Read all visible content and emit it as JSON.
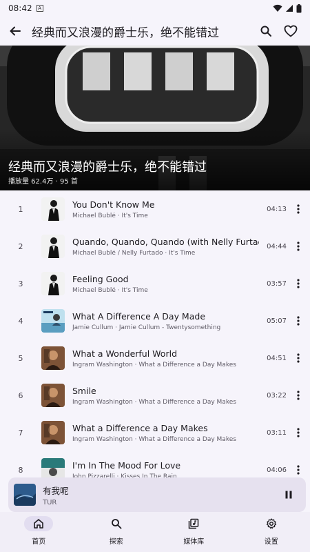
{
  "status": {
    "time": "08:42",
    "badge": "A"
  },
  "app_bar": {
    "title": "经典而又浪漫的爵士乐，绝不能错过",
    "icons": [
      "back-arrow-icon",
      "search-icon",
      "heart-icon"
    ]
  },
  "hero": {
    "title": "经典而又浪漫的爵士乐，绝不能错过",
    "meta": "播放量 62.4万 · 95 首"
  },
  "songs": [
    {
      "index": "1",
      "title": "You Don't Know Me",
      "subtitle": "Michael Bublé · It's Time",
      "duration": "04:13",
      "cover": "bw"
    },
    {
      "index": "2",
      "title": "Quando, Quando, Quando (with Nelly Furtado)",
      "subtitle": "Michael Bublé / Nelly Furtado · It's Time",
      "duration": "04:44",
      "cover": "bw"
    },
    {
      "index": "3",
      "title": "Feeling Good",
      "subtitle": "Michael Bublé · It's Time",
      "duration": "03:57",
      "cover": "bw"
    },
    {
      "index": "4",
      "title": "What A Difference A Day Made",
      "subtitle": "Jamie Cullum · Jamie Cullum - Twentysomething",
      "duration": "05:07",
      "cover": "blue"
    },
    {
      "index": "5",
      "title": "What a Wonderful World",
      "subtitle": "Ingram Washington · What a Difference a Day Makes",
      "duration": "04:51",
      "cover": "warm"
    },
    {
      "index": "6",
      "title": "Smile",
      "subtitle": "Ingram Washington · What a Difference a Day Makes",
      "duration": "03:22",
      "cover": "warm"
    },
    {
      "index": "7",
      "title": "What a Difference a Day Makes",
      "subtitle": "Ingram Washington · What a Difference a Day Makes",
      "duration": "03:11",
      "cover": "warm"
    },
    {
      "index": "8",
      "title": "I'm In The Mood For Love",
      "subtitle": "John Pizzarelli · Kisses In The Rain",
      "duration": "04:06",
      "cover": "teal"
    }
  ],
  "mini_player": {
    "title": "有我呢",
    "artist": "TUR"
  },
  "nav": [
    {
      "label": "首页",
      "icon": "home-icon",
      "active": true
    },
    {
      "label": "探索",
      "icon": "search-icon",
      "active": false
    },
    {
      "label": "媒体库",
      "icon": "library-icon",
      "active": false
    },
    {
      "label": "设置",
      "icon": "settings-icon",
      "active": false
    }
  ],
  "colors": {
    "background": "#f6f4fb",
    "mini_player": "#e6e1ef",
    "nav_active": "#e2ddf0"
  }
}
